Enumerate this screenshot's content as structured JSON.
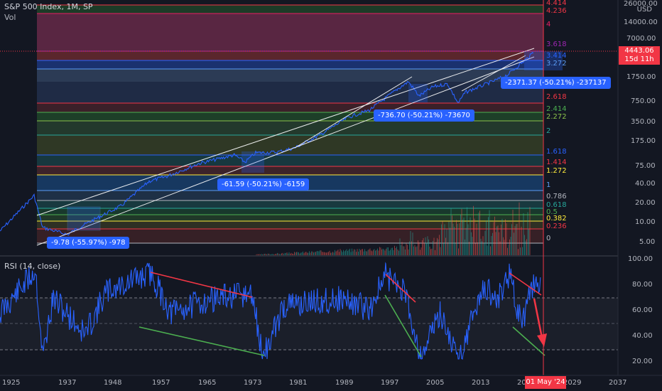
{
  "header": {
    "symbol_title": "S&P 500 Index, 1M, SP",
    "volume_label": "Vol",
    "currency": "USD",
    "rsi_title": "RSI (14, close)"
  },
  "price_tag": {
    "price": "4443.06",
    "countdown": "15d 11h"
  },
  "cursor_date": "01 May '24",
  "price_axis": [
    "26000.00",
    "14000.00",
    "7000.00",
    "1750.00",
    "750.00",
    "350.00",
    "175.00",
    "75.00",
    "40.00",
    "20.00",
    "10.00",
    "5.00"
  ],
  "rsi_axis": [
    "100.00",
    "80.00",
    "60.00",
    "40.00",
    "20.00"
  ],
  "time_axis": [
    "1925",
    "1937",
    "1948",
    "1957",
    "1965",
    "1973",
    "1981",
    "1989",
    "1997",
    "2005",
    "2013",
    "20",
    "2029",
    "2037"
  ],
  "fib_levels": [
    {
      "label": "4.414",
      "color": "#f23645"
    },
    {
      "label": "4.236",
      "color": "#f23645"
    },
    {
      "label": "4",
      "color": "#e91e63"
    },
    {
      "label": "3.618",
      "color": "#9c27b0"
    },
    {
      "label": "3.414",
      "color": "#2962ff"
    },
    {
      "label": "3.272",
      "color": "#5b9cf6"
    },
    {
      "label": "2.618",
      "color": "#f23645"
    },
    {
      "label": "2.414",
      "color": "#4caf50"
    },
    {
      "label": "2.272",
      "color": "#8bc34a"
    },
    {
      "label": "2",
      "color": "#26a69a"
    },
    {
      "label": "1.618",
      "color": "#2962ff"
    },
    {
      "label": "1.414",
      "color": "#f23645"
    },
    {
      "label": "1.272",
      "color": "#ffeb3b"
    },
    {
      "label": "1",
      "color": "#5b9cf6"
    },
    {
      "label": "0.786",
      "color": "#b2b5be"
    },
    {
      "label": "0.618",
      "color": "#26a69a"
    },
    {
      "label": "0.5",
      "color": "#4caf50"
    },
    {
      "label": "0.382",
      "color": "#ffeb3b"
    },
    {
      "label": "0.236",
      "color": "#f23645"
    },
    {
      "label": "0",
      "color": "#b2b5be"
    }
  ],
  "measurements": [
    "-9.78 (-55.97%) -978",
    "-61.59 (-50.21%) -6159",
    "-736.70 (-50.21%) -73670",
    "-2371.37 (-50.21%) -237137"
  ],
  "colors": {
    "background": "#131722",
    "price_line": "#2962ff",
    "rsi_line": "#2962ff",
    "divergence_bear": "#f23645",
    "divergence_bull": "#4caf50",
    "cursor": "#f23645",
    "measure_box": "#2962ff"
  }
}
